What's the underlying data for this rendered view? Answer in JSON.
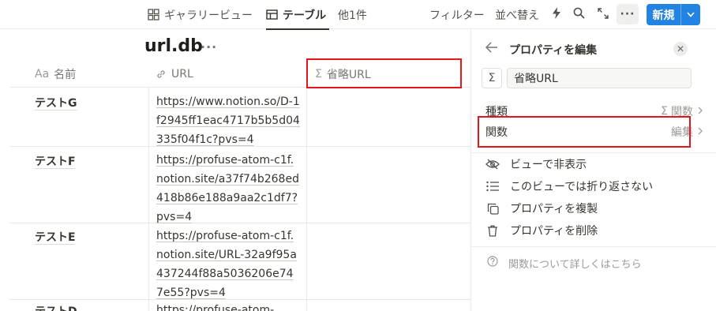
{
  "toolbar": {
    "views": [
      {
        "label": "ギャラリービュー",
        "icon": "gallery-icon"
      },
      {
        "label": "テーブル",
        "icon": "table-icon"
      },
      {
        "label": "他1件"
      }
    ],
    "filter_label": "フィルター",
    "sort_label": "並べ替え",
    "new_label": "新規",
    "more_label": "···"
  },
  "page": {
    "title": "url.db",
    "title_more": "···"
  },
  "table": {
    "columns": [
      {
        "label": "名前",
        "icon": "text-type-icon",
        "icon_text": "Aa"
      },
      {
        "label": "URL",
        "icon": "link-icon"
      },
      {
        "label": "省略URL",
        "icon": "sigma-icon",
        "icon_text": "Σ"
      }
    ],
    "rows": [
      {
        "name": "テストG",
        "url": "https://www.notion.so/D-1f2945ff1eac4717b5b5d04335f04f1c?pvs=4"
      },
      {
        "name": "テストF",
        "url": "https://profuse-atom-c1f.notion.site/a37f74b268ed418b86e188a9aa2c1df7?pvs=4"
      },
      {
        "name": "テストE",
        "url": "https://profuse-atom-c1f.notion.site/URL-32a9f95a437244f88a5036206e747e55?pvs=4"
      },
      {
        "name": "テストD",
        "url": "https://profuse-atom-"
      }
    ]
  },
  "panel": {
    "title": "プロパティを編集",
    "name_value": "省略URL",
    "type_label": "種類",
    "type_value": "関数",
    "formula_label": "関数",
    "formula_value": "編集",
    "actions": [
      {
        "label": "ビューで非表示",
        "icon": "eye-slash-icon"
      },
      {
        "label": "このビューでは折り返さない",
        "icon": "list-icon"
      },
      {
        "label": "プロパティを複製",
        "icon": "duplicate-icon"
      },
      {
        "label": "プロパティを削除",
        "icon": "trash-icon"
      }
    ],
    "help": "関数について詳しくはこちら"
  },
  "colors": {
    "accent": "#2383e2",
    "highlight": "#e3151d"
  }
}
